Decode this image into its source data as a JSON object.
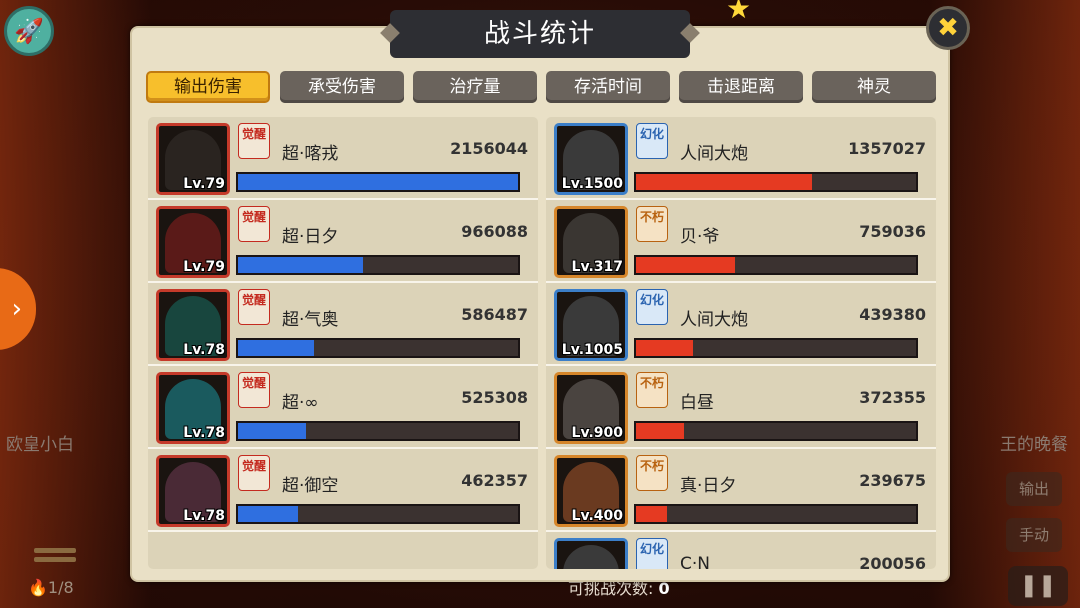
{
  "title": "战斗统计",
  "close_label": "✖",
  "tabs": [
    {
      "label": "输出伤害",
      "active": true
    },
    {
      "label": "承受伤害",
      "active": false
    },
    {
      "label": "治疗量",
      "active": false
    },
    {
      "label": "存活时间",
      "active": false
    },
    {
      "label": "击退距离",
      "active": false
    },
    {
      "label": "神灵",
      "active": false
    }
  ],
  "left_team": [
    {
      "name": "超·喀戎",
      "value": "2156044",
      "level": "Lv.79",
      "badge": "觉醒",
      "fill": 1.0,
      "art": "#2a2420"
    },
    {
      "name": "超·日夕",
      "value": "966088",
      "level": "Lv.79",
      "badge": "觉醒",
      "fill": 0.448,
      "art": "#5a1a18"
    },
    {
      "name": "超·气奥",
      "value": "586487",
      "level": "Lv.78",
      "badge": "觉醒",
      "fill": 0.272,
      "art": "#18463e"
    },
    {
      "name": "超·∞",
      "value": "525308",
      "level": "Lv.78",
      "badge": "觉醒",
      "fill": 0.244,
      "art": "#1a5a5e"
    },
    {
      "name": "超·御空",
      "value": "462357",
      "level": "Lv.78",
      "badge": "觉醒",
      "fill": 0.214,
      "art": "#4a2a36"
    }
  ],
  "right_team": [
    {
      "name": "人间大炮",
      "value": "1357027",
      "level": "Lv.1500",
      "badge": "幻化",
      "fill": 0.63,
      "art": "#3a3a3a"
    },
    {
      "name": "贝·爷",
      "value": "759036",
      "level": "Lv.317",
      "badge": "不朽",
      "fill": 0.352,
      "art": "#3a3632"
    },
    {
      "name": "人间大炮",
      "value": "439380",
      "level": "Lv.1005",
      "badge": "幻化",
      "fill": 0.204,
      "art": "#3a3a3a"
    },
    {
      "name": "白昼",
      "value": "372355",
      "level": "Lv.900",
      "badge": "不朽",
      "fill": 0.173,
      "art": "#4a4440"
    },
    {
      "name": "真·日夕",
      "value": "239675",
      "level": "Lv.400",
      "badge": "不朽",
      "fill": 0.111,
      "art": "#6a3a20"
    },
    {
      "name": "C·N",
      "value": "200056",
      "level": "",
      "badge": "幻化",
      "fill": 0.09,
      "art": "#3a3a3a"
    }
  ],
  "background": {
    "left_player": "欧皇小白",
    "right_player": "王的晚餐",
    "side_buttons": [
      "输出",
      "手动"
    ],
    "wave": "1/8",
    "remaining_label": "可挑战次数:",
    "remaining_value": "0"
  }
}
